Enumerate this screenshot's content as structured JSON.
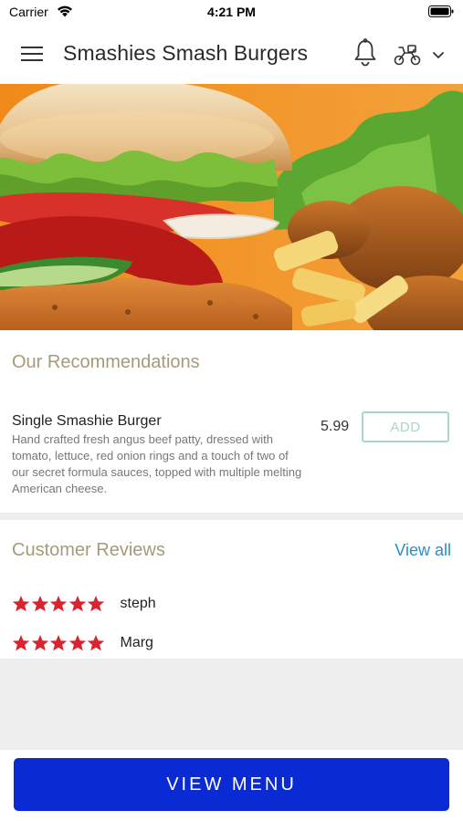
{
  "status_bar": {
    "carrier": "Carrier",
    "time": "4:21 PM"
  },
  "header": {
    "title": "Smashies Smash Burgers"
  },
  "recommendations": {
    "heading": "Our Recommendations",
    "items": [
      {
        "name": "Single Smashie Burger",
        "description": "Hand crafted fresh angus beef patty, dressed with tomato, lettuce, red onion rings and a touch of two of our secret formula sauces, topped with multiple melting American cheese.",
        "price": "5.99",
        "add_label": "ADD"
      }
    ]
  },
  "reviews": {
    "heading": "Customer Reviews",
    "view_all_label": "View all",
    "items": [
      {
        "reviewer": "steph",
        "rating": 5
      },
      {
        "reviewer": "Marg",
        "rating": 5
      }
    ]
  },
  "footer": {
    "view_menu_label": "VIEW MENU"
  },
  "colors": {
    "accent_heading": "#a79a7a",
    "link": "#2a8fc7",
    "add_button": "#a8d8bf",
    "primary_button": "#0a2ad4",
    "star": "#d9232e"
  },
  "icons": [
    "wifi-icon",
    "battery-icon",
    "menu-icon",
    "bell-icon",
    "delivery-icon",
    "chevron-down-icon",
    "star-icon"
  ]
}
